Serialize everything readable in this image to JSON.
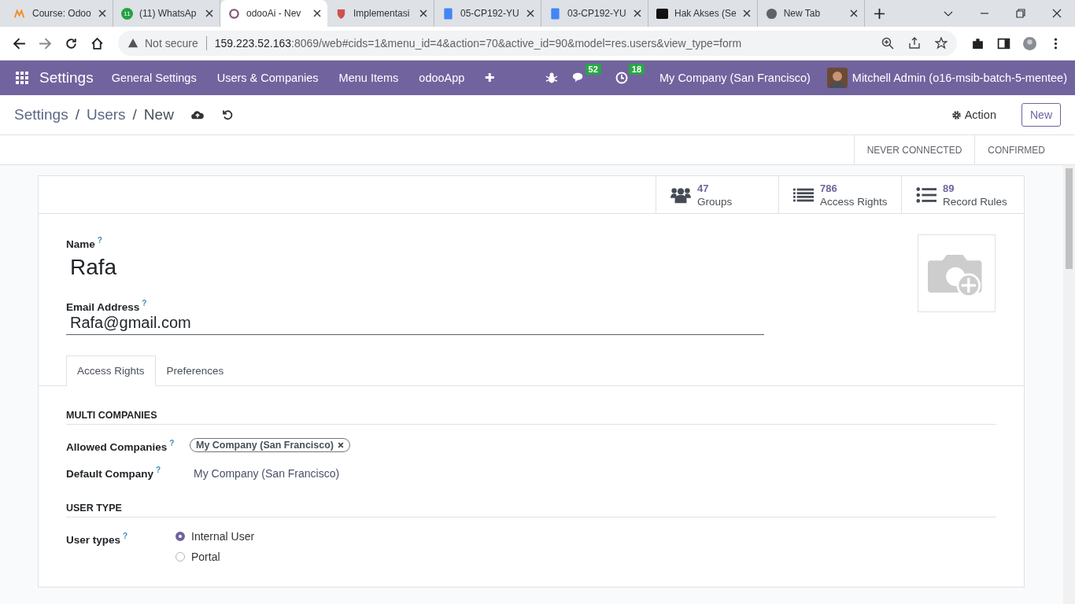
{
  "browser": {
    "tabs": [
      {
        "title": "Course: Odoo",
        "kind": "moodle",
        "selected": false
      },
      {
        "title": "(11) WhatsAp",
        "kind": "whatsapp",
        "badge": "11",
        "selected": false
      },
      {
        "title": "odooAi - Nev",
        "kind": "odoo",
        "selected": true
      },
      {
        "title": "Implementasi",
        "kind": "shield",
        "selected": false
      },
      {
        "title": "05-CP192-YU",
        "kind": "doc",
        "selected": false
      },
      {
        "title": "03-CP192-YU",
        "kind": "doc",
        "selected": false
      },
      {
        "title": "Hak Akses (Se",
        "kind": "medium",
        "selected": false
      },
      {
        "title": "New Tab",
        "kind": "chrome",
        "selected": false
      }
    ],
    "security": "Not secure",
    "url_host": "159.223.52.163",
    "url_rest": ":8069/web#cids=1&menu_id=4&action=70&active_id=90&model=res.users&view_type=form"
  },
  "navbar": {
    "app": "Settings",
    "menus": [
      "General Settings",
      "Users & Companies",
      "Menu Items",
      "odooApp"
    ],
    "add": "✚",
    "messages": "52",
    "activities": "18",
    "company": "My Company (San Francisco)",
    "user": "Mitchell Admin (o16-msib-batch-5-mentee)"
  },
  "breadcrumb": [
    {
      "label": "Settings",
      "separator": "/"
    },
    {
      "label": "Users",
      "separator": "/"
    },
    {
      "label": "New"
    }
  ],
  "action": "Action",
  "new_button": "New",
  "statusbar": [
    {
      "label": "NEVER CONNECTED",
      "selected": false
    },
    {
      "label": "CONFIRMED",
      "selected": false
    }
  ],
  "smart_buttons": [
    {
      "count": "47",
      "label": "Groups",
      "kind": "users"
    },
    {
      "count": "786",
      "label": "Access Rights",
      "kind": "list"
    },
    {
      "count": "89",
      "label": "Record Rules",
      "kind": "bullets"
    }
  ],
  "name_label": "Name",
  "name_help": "?",
  "name": "Rafa",
  "email_label": "Email Address",
  "email_help": "?",
  "email": "Rafa@gmail.com",
  "form_tabs": [
    {
      "label": "Access Rights",
      "selected": true
    },
    {
      "label": "Preferences",
      "selected": false
    }
  ],
  "sections": [
    {
      "title": "MULTI COMPANIES",
      "fields": [
        {
          "label": "Allowed Companies",
          "help": "?",
          "kind": "tags",
          "tags": [
            "My Company (San Francisco)"
          ]
        },
        {
          "label": "Default Company",
          "help": "?",
          "kind": "text",
          "value": "My Company (San Francisco)"
        }
      ]
    },
    {
      "title": "USER TYPE",
      "fields": [
        {
          "label": "User types",
          "help": "?",
          "kind": "radio",
          "options": [
            {
              "label": "Internal User",
              "selected": true
            },
            {
              "label": "Portal",
              "selected": false
            }
          ]
        }
      ]
    }
  ]
}
